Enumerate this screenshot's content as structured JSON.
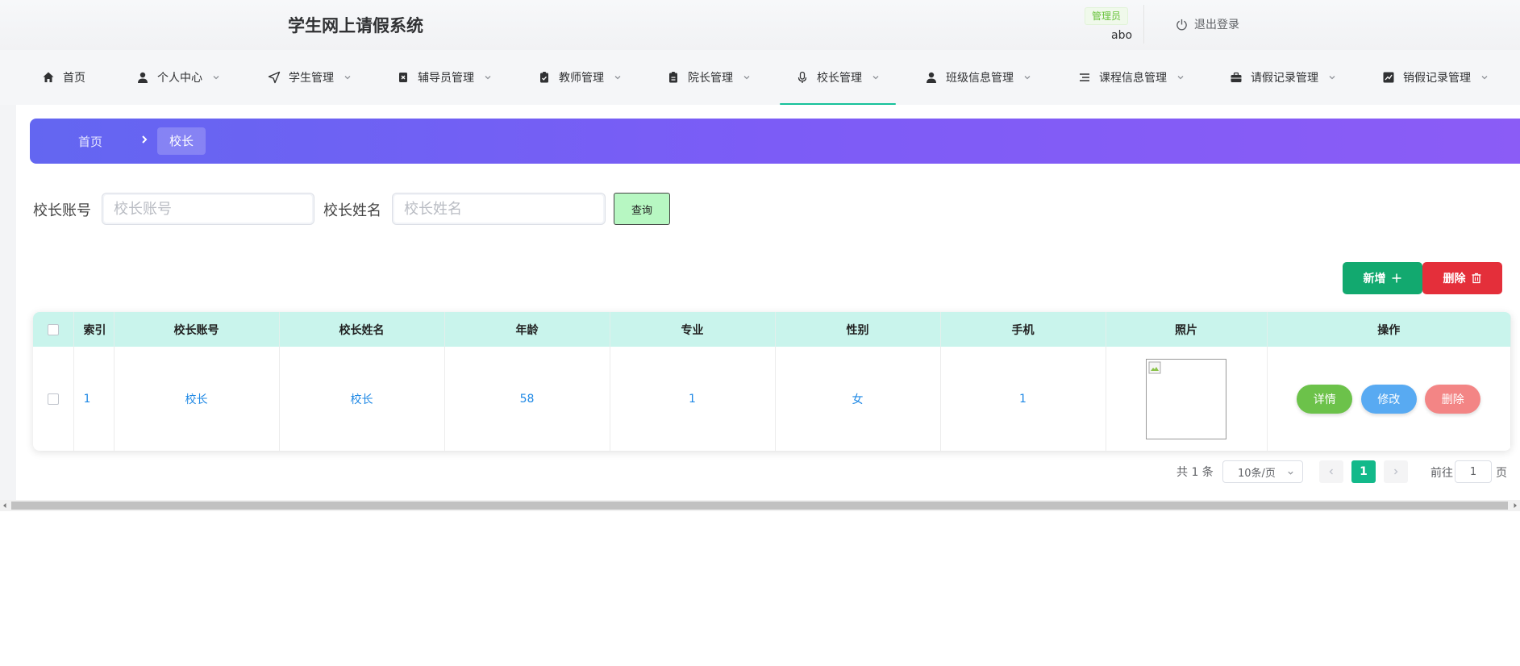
{
  "header": {
    "title": "学生网上请假系统",
    "role_badge": "管理员",
    "username": "abo",
    "logout_label": "退出登录"
  },
  "nav": {
    "items": [
      {
        "label": "首页",
        "icon": "home-icon"
      },
      {
        "label": "个人中心",
        "icon": "user-icon"
      },
      {
        "label": "学生管理",
        "icon": "send-icon"
      },
      {
        "label": "辅导员管理",
        "icon": "close-box-icon"
      },
      {
        "label": "教师管理",
        "icon": "check-clipboard-icon"
      },
      {
        "label": "院长管理",
        "icon": "clipboard-icon"
      },
      {
        "label": "校长管理",
        "icon": "microphone-icon"
      },
      {
        "label": "班级信息管理",
        "icon": "user-icon"
      },
      {
        "label": "课程信息管理",
        "icon": "list-icon"
      },
      {
        "label": "请假记录管理",
        "icon": "briefcase-icon"
      },
      {
        "label": "销假记录管理",
        "icon": "chart-icon"
      }
    ],
    "active_index": 6
  },
  "breadcrumb": {
    "home": "首页",
    "current": "校长"
  },
  "search": {
    "account_label": "校长账号",
    "account_placeholder": "校长账号",
    "name_label": "校长姓名",
    "name_placeholder": "校长姓名",
    "query_label": "查询"
  },
  "actions": {
    "add_label": "新增",
    "delete_label": "删除"
  },
  "table": {
    "columns": [
      "索引",
      "校长账号",
      "校长姓名",
      "年龄",
      "专业",
      "性别",
      "手机",
      "照片",
      "操作"
    ],
    "rows": [
      {
        "index": "1",
        "account": "校长",
        "name": "校长",
        "age": "58",
        "major": "1",
        "gender": "女",
        "phone": "1"
      }
    ],
    "row_actions": {
      "detail": "详情",
      "edit": "修改",
      "delete": "删除"
    }
  },
  "pagination": {
    "total": "共 1 条",
    "page_size": "10条/页",
    "current_page": "1",
    "goto_label": "前往",
    "goto_value": "1",
    "goto_suffix": "页"
  },
  "colors": {
    "accent": "#16c19a",
    "breadcrumb_start": "#6366f1",
    "breadcrumb_end": "#8b5cf6",
    "table_header": "#c9f4ec",
    "add_button": "#12a96f",
    "delete_button": "#e42f3a"
  }
}
